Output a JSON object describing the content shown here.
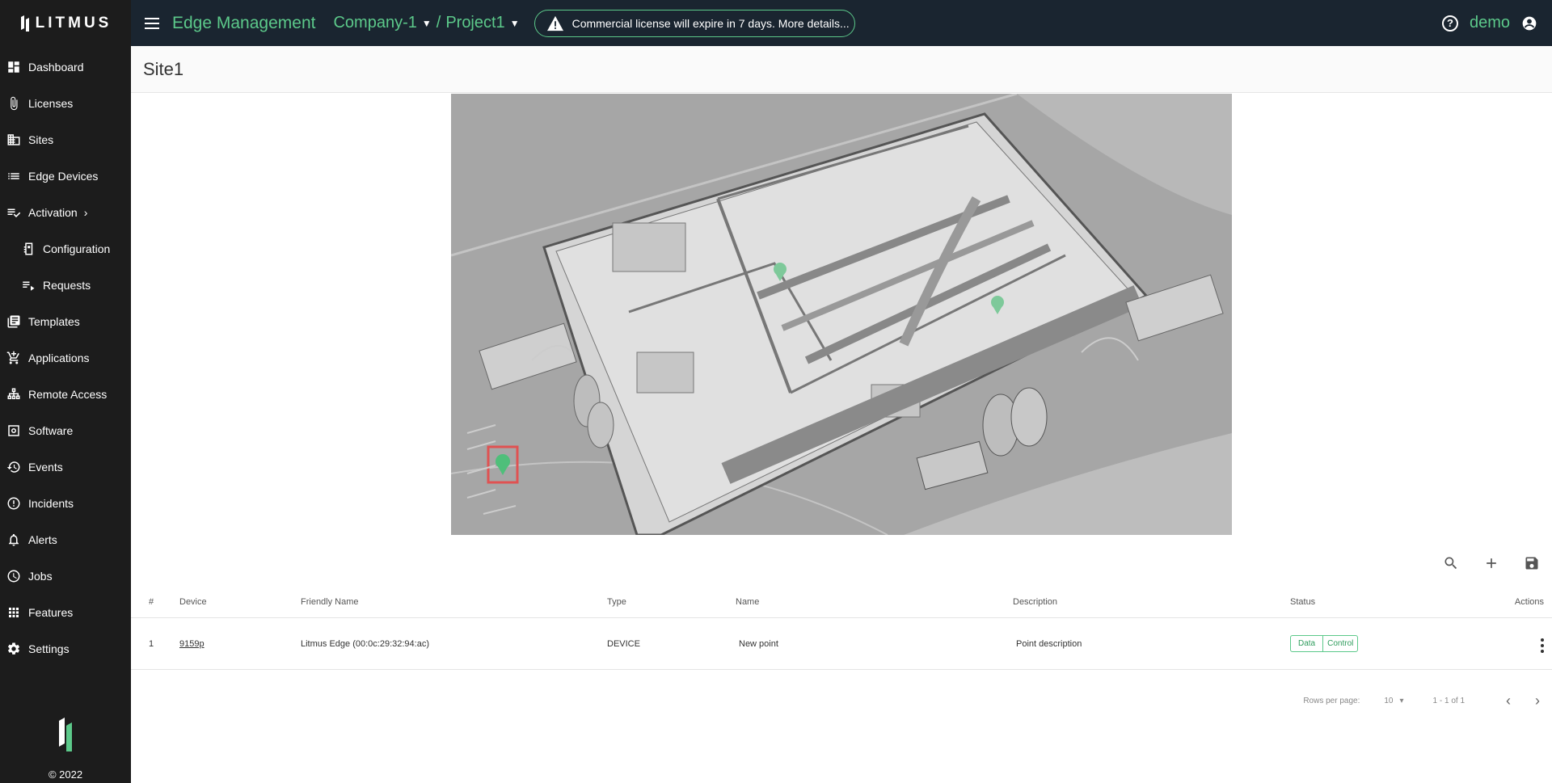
{
  "sidebar": {
    "brand": "LITMUS",
    "items": [
      {
        "label": "Dashboard"
      },
      {
        "label": "Licenses"
      },
      {
        "label": "Sites"
      },
      {
        "label": "Edge Devices"
      },
      {
        "label": "Activation"
      },
      {
        "label": "Configuration"
      },
      {
        "label": "Requests"
      },
      {
        "label": "Templates"
      },
      {
        "label": "Applications"
      },
      {
        "label": "Remote Access"
      },
      {
        "label": "Software"
      },
      {
        "label": "Events"
      },
      {
        "label": "Incidents"
      },
      {
        "label": "Alerts"
      },
      {
        "label": "Jobs"
      },
      {
        "label": "Features"
      },
      {
        "label": "Settings"
      }
    ],
    "copyright": "© 2022"
  },
  "header": {
    "title": "Edge Management",
    "company": "Company-1",
    "project": "Project1",
    "separator": "/",
    "license_notice": "Commercial license will expire in 7 days. More details...",
    "user": "demo"
  },
  "page": {
    "title": "Site1"
  },
  "table": {
    "columns": {
      "index": "#",
      "device": "Device",
      "friendly_name": "Friendly Name",
      "type": "Type",
      "name": "Name",
      "description": "Description",
      "status": "Status",
      "actions": "Actions"
    },
    "rows": [
      {
        "index": "1",
        "device": "9159p",
        "friendly_name": "Litmus Edge (00:0c:29:32:94:ac)",
        "type": "DEVICE",
        "name": "New point",
        "description": "Point description",
        "status_data": "Data",
        "status_control": "Control"
      }
    ]
  },
  "pagination": {
    "rows_per_page_label": "Rows per page:",
    "rows_per_page": "10",
    "range": "1 - 1 of 1"
  },
  "colors": {
    "accent": "#5cc98a",
    "topbar": "#1a2530",
    "sidebar": "#1c1c1c"
  }
}
